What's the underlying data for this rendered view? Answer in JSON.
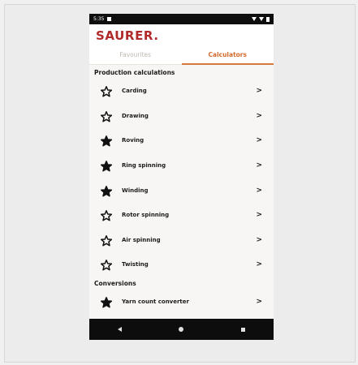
{
  "status_bar": {
    "time": "5:35"
  },
  "app": {
    "logo": "SAURER."
  },
  "tabs": [
    {
      "label": "Favourites",
      "active": false
    },
    {
      "label": "Calculators",
      "active": true
    }
  ],
  "sections": {
    "production": {
      "title": "Production calculations",
      "items": [
        {
          "label": "Carding",
          "favourite": false
        },
        {
          "label": "Drawing",
          "favourite": false
        },
        {
          "label": "Roving",
          "favourite": true
        },
        {
          "label": "Ring spinning",
          "favourite": true
        },
        {
          "label": "Winding",
          "favourite": true
        },
        {
          "label": "Rotor spinning",
          "favourite": false
        },
        {
          "label": "Air spinning",
          "favourite": false
        },
        {
          "label": "Twisting",
          "favourite": false
        }
      ]
    },
    "conversions": {
      "title": "Conversions",
      "items": [
        {
          "label": "Yarn count converter",
          "favourite": true
        }
      ]
    }
  },
  "colors": {
    "brand": "#b12a2a",
    "accent": "#d46a2b",
    "background": "#f7f6f4"
  },
  "chevron": ">"
}
